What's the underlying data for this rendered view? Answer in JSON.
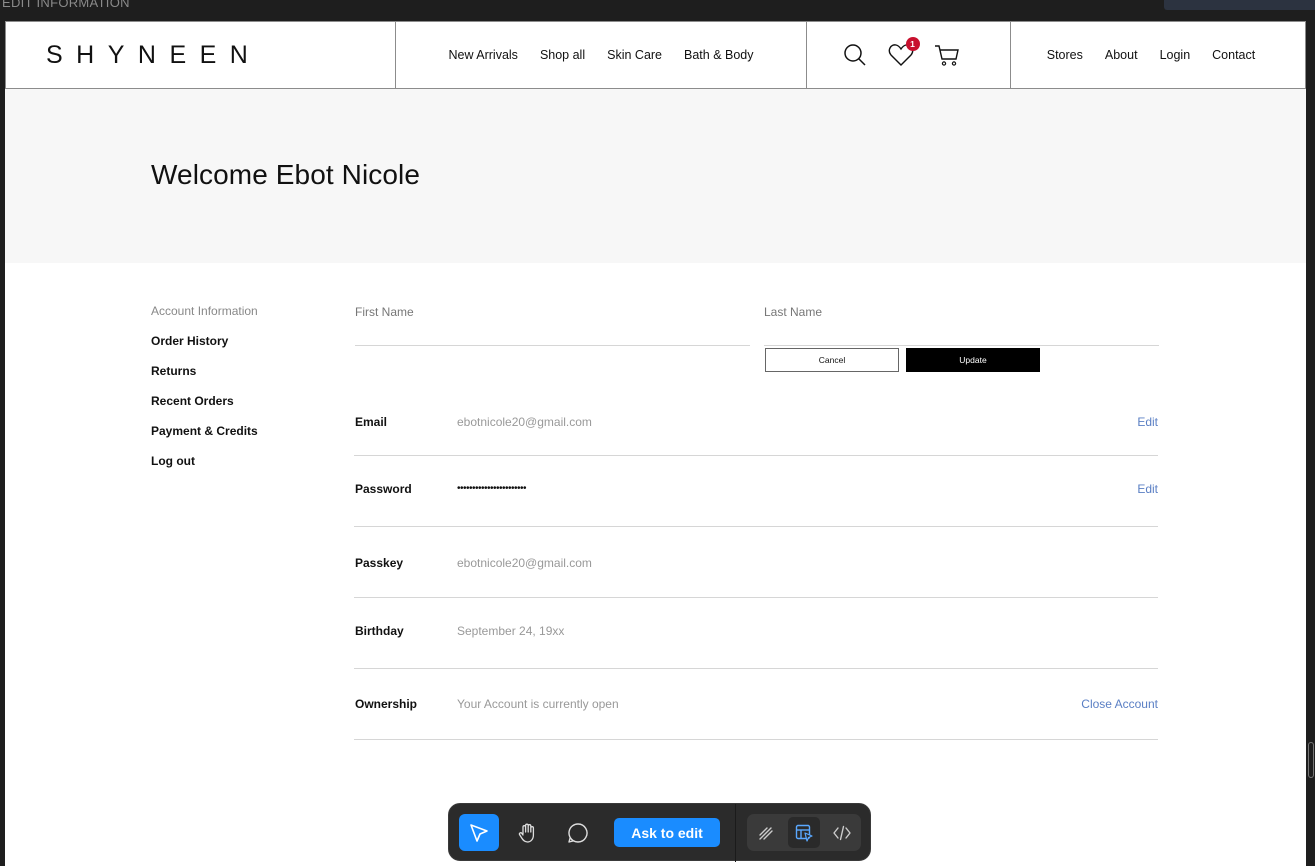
{
  "frame": {
    "label": "EDIT INFORMATION"
  },
  "header": {
    "logo": "SHYNEEN",
    "nav": [
      "New Arrivals",
      "Shop all",
      "Skin Care",
      "Bath & Body"
    ],
    "wishlist_count": "1",
    "links": [
      "Stores",
      "About",
      "Login",
      "Contact"
    ]
  },
  "hero": {
    "title": "Welcome Ebot Nicole"
  },
  "sidebar": {
    "items": [
      "Account Information",
      "Order History",
      "Returns",
      "Recent Orders",
      "Payment & Credits",
      "Log out"
    ]
  },
  "name_form": {
    "first_name_placeholder": "First Name",
    "last_name_placeholder": "Last Name",
    "cancel_label": "Cancel",
    "update_label": "Update"
  },
  "account": {
    "email": {
      "label": "Email",
      "value": "ebotnicole20@gmail.com",
      "action": "Edit"
    },
    "password": {
      "label": "Password",
      "value": "•••••••••••••••••••••••",
      "action": "Edit"
    },
    "passkey": {
      "label": "Passkey",
      "value": "ebotnicole20@gmail.com"
    },
    "birthday": {
      "label": "Birthday",
      "value": "September 24, 19xx"
    },
    "ownership": {
      "label": "Ownership",
      "value": "Your Account is currently open",
      "action": "Close Account"
    }
  },
  "toolbar": {
    "ask_label": "Ask to edit"
  },
  "colors": {
    "accent": "#1a8cff",
    "link": "#5a7fc4",
    "badge": "#c8102e",
    "update_button": "#000000"
  }
}
